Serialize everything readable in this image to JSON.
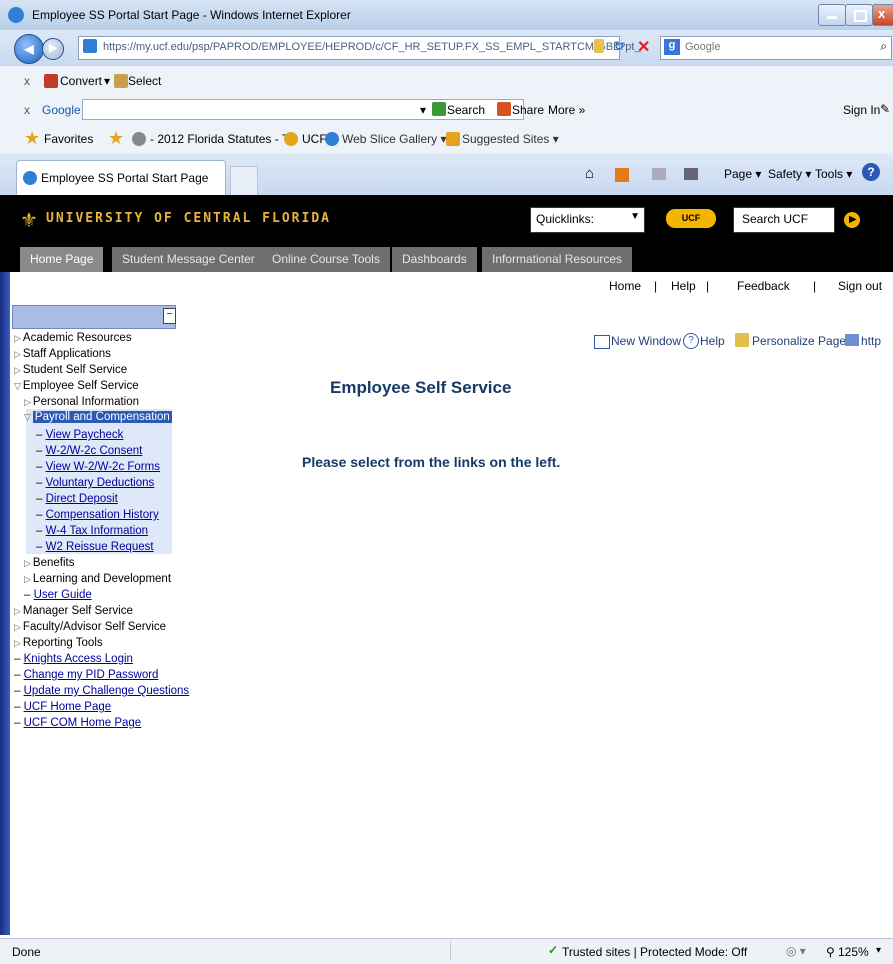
{
  "window": {
    "title": "Employee SS Portal Start Page - Windows Internet Explorer",
    "url": "https://my.ucf.edu/psp/PAPROD/EMPLOYEE/HEPROD/c/CF_HR_SETUP.FX_SS_EMPL_STARTCM.GBL?pt_",
    "search_placeholder": "Google"
  },
  "toolbar1": {
    "close": "x",
    "convert": "Convert",
    "select": "Select"
  },
  "toolbar2": {
    "close": "x",
    "google": "Google",
    "search": "Search",
    "share": "Share",
    "more": "More »",
    "sign_in": "Sign In"
  },
  "favorites": {
    "label": "Favorites",
    "items": [
      "- 2012 Florida Statutes - T...",
      "UCF",
      "Web Slice Gallery ▾",
      "Suggested Sites ▾"
    ]
  },
  "tab": {
    "label": "Employee SS Portal Start Page"
  },
  "cmdbar": {
    "page": "Page ▾",
    "safety": "Safety ▾",
    "tools": "Tools ▾"
  },
  "ucf": {
    "name": "UNIVERSITY OF CENTRAL FLORIDA",
    "quicklinks": "Quicklinks:",
    "logo_btn": "UCF",
    "search": "Search UCF"
  },
  "nav_tabs": [
    "Home Page",
    "Student Message Center",
    "Online Course Tools",
    "Dashboards",
    "Informational Resources"
  ],
  "top_links": {
    "home": "Home",
    "help": "Help",
    "feedback": "Feedback",
    "signout": "Sign out",
    "sep": "|"
  },
  "actions": {
    "new_window": "New Window",
    "help": "Help",
    "personalize": "Personalize Page",
    "http": "http"
  },
  "sidebar": {
    "collapse": "−",
    "academic": "Academic Resources",
    "staff": "Staff Applications",
    "student": "Student Self Service",
    "employee": "Employee Self Service",
    "personal": "Personal Information",
    "payroll": "Payroll and Compensation",
    "sub": [
      "View Paycheck",
      "W-2/W-2c Consent",
      "View W-2/W-2c Forms",
      "Voluntary Deductions",
      "Direct Deposit",
      "Compensation History",
      "W-4 Tax Information",
      "W2 Reissue Request"
    ],
    "benefits": "Benefits",
    "learning": "Learning and Development",
    "user_guide": "User Guide",
    "manager": "Manager Self Service",
    "faculty": "Faculty/Advisor Self Service",
    "reporting": "Reporting Tools",
    "knights": "Knights Access Login",
    "pid": "Change my PID Password",
    "challenge": "Update my Challenge Questions",
    "ucf_home": "UCF Home Page",
    "ucf_com": "UCF COM Home Page"
  },
  "main": {
    "title": "Employee Self Service",
    "prompt": "Please select from the links on the left."
  },
  "status": {
    "left": "Done",
    "zone": "Trusted sites | Protected Mode: Off",
    "zoom": "125%"
  }
}
